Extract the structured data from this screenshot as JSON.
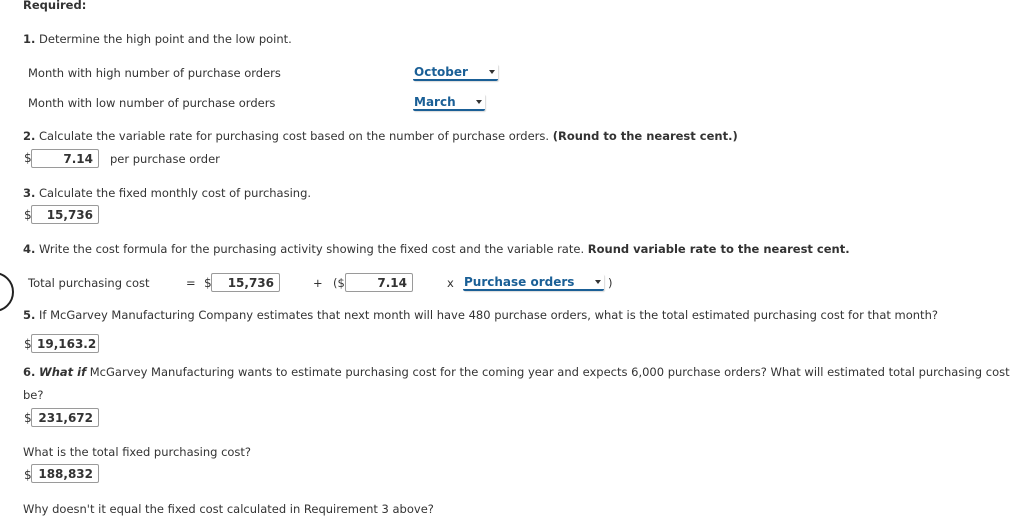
{
  "required_heading": "Required:",
  "q1": {
    "number": "1.",
    "text": " Determine the high point and the low point.",
    "rows": [
      {
        "label": "Month with high number of purchase orders",
        "selected": "October"
      },
      {
        "label": "Month with low number of purchase orders",
        "selected": "March"
      }
    ]
  },
  "q2": {
    "number": "2.",
    "text": " Calculate the variable rate for purchasing cost based on the number of purchase orders. ",
    "instruction": "(Round to the nearest cent.)",
    "currency": "$",
    "value": "7.14",
    "unit": "per purchase order"
  },
  "q3": {
    "number": "3.",
    "text": " Calculate the fixed monthly cost of purchasing.",
    "currency": "$",
    "value": "15,736"
  },
  "q4": {
    "number": "4.",
    "text": " Write the cost formula for the purchasing activity showing the fixed cost and the variable rate. ",
    "instruction": "Round variable rate to the nearest cent.",
    "formula": {
      "label": "Total purchasing cost",
      "equals": "=",
      "currency": "$",
      "fixed_value": "15,736",
      "plus": "+",
      "open_paren": "($",
      "rate_value": "7.14",
      "times": "x",
      "driver_selected": "Purchase orders",
      "close_paren": ")"
    }
  },
  "q5": {
    "number": "5.",
    "text": " If McGarvey Manufacturing Company estimates that next month will have 480 purchase orders, what is the total estimated purchasing cost for that month?",
    "currency": "$",
    "value": "19,163.2"
  },
  "q6": {
    "number": "6.",
    "what_if": "What if",
    "text": " McGarvey Manufacturing wants to estimate purchasing cost for the coming year and expects 6,000 purchase orders? What will estimated total purchasing cost",
    "text_cont": "be?",
    "currency": "$",
    "value": "231,672",
    "fixed_question": "What is the total fixed purchasing cost?",
    "fixed_currency": "$",
    "fixed_value": "188,832",
    "why_question": "Why doesn't it equal the fixed cost calculated in Requirement 3 above?"
  },
  "colors": {
    "select_accent": "#1a5f96",
    "text": "#333333"
  }
}
